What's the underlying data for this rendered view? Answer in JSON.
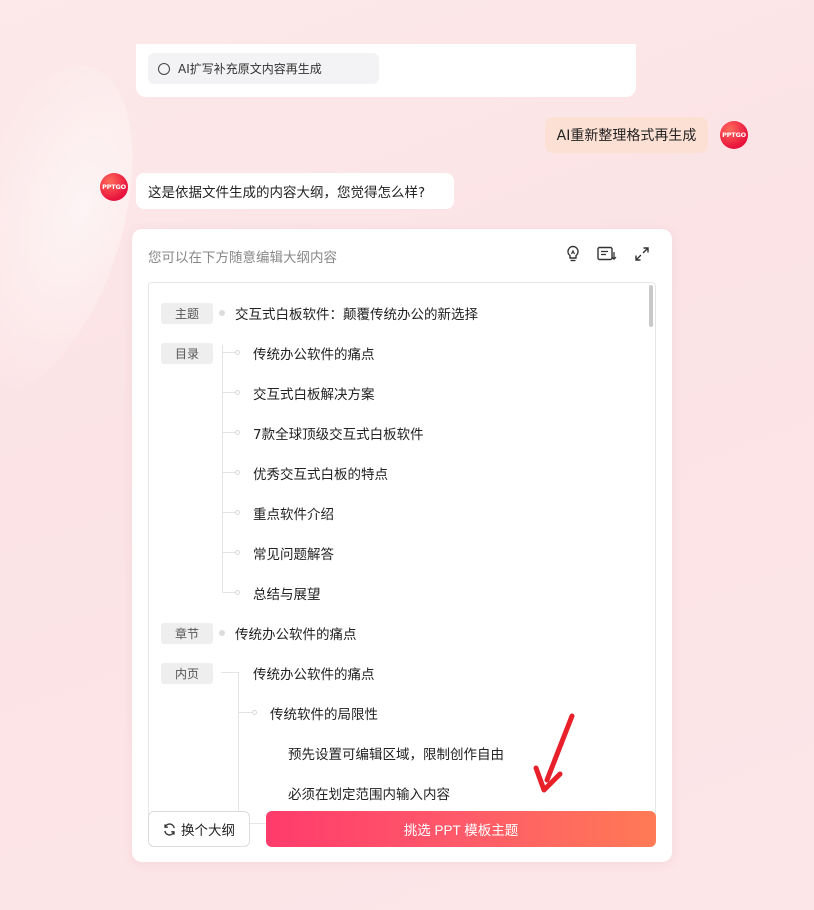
{
  "previous_option": {
    "label": "AI扩写补充原文内容再生成"
  },
  "user_message": "AI重新整理格式再生成",
  "bot_message": "这是依据文件生成的内容大纲，您觉得怎么样?",
  "avatar_text": "PPTGO",
  "editor": {
    "hint": "您可以在下方随意编辑大纲内容",
    "tools": [
      "lightbulb-icon",
      "list-download-icon",
      "expand-icon"
    ]
  },
  "outline": {
    "tags": {
      "theme": "主题",
      "toc": "目录",
      "chapter": "章节",
      "inner": "内页"
    },
    "theme_title": "交互式白板软件：颠覆传统办公的新选择",
    "toc_items": [
      "传统办公软件的痛点",
      "交互式白板解决方案",
      "7款全球顶级交互式白板软件",
      "优秀交互式白板的特点",
      "重点软件介绍",
      "常见问题解答",
      "总结与展望"
    ],
    "chapter_title": "传统办公软件的痛点",
    "inner_title": "传统办公软件的痛点",
    "sub_title": "传统软件的局限性",
    "bullets": [
      "预先设置可编辑区域，限制创作自由",
      "必须在划定范围内输入内容"
    ]
  },
  "buttons": {
    "change_outline": "换个大纲",
    "pick_template": "挑选 PPT 模板主题"
  },
  "colors": {
    "primary_start": "#ff3b6b",
    "primary_end": "#ff7a55",
    "user_bubble": "#fde0d4",
    "arrow": "#e8202a"
  }
}
